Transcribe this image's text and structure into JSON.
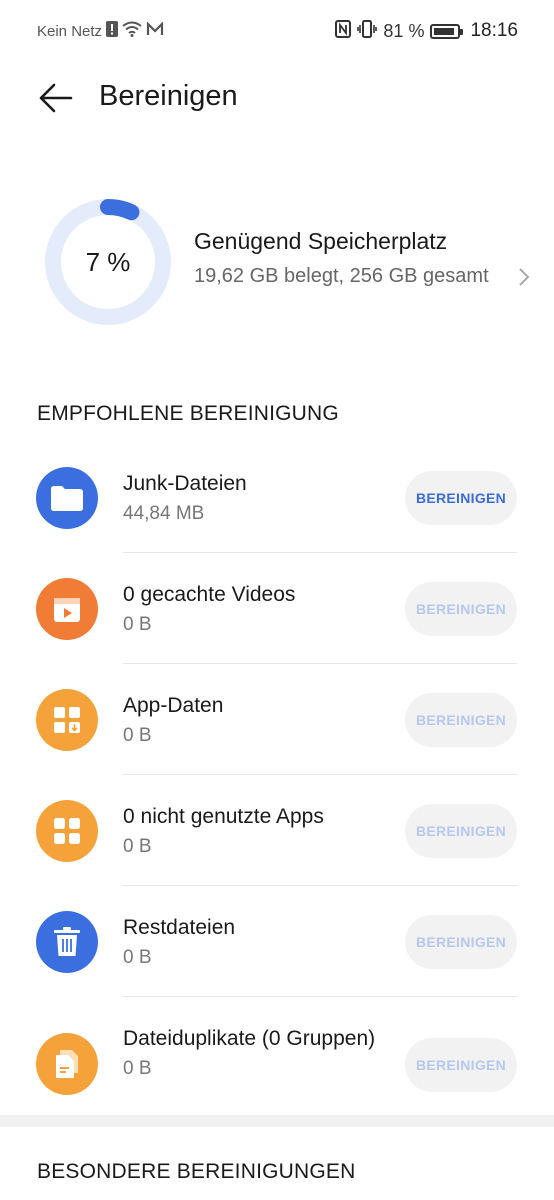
{
  "status_bar": {
    "carrier": "Kein Netz",
    "battery": "81 %",
    "time": "18:16"
  },
  "header": {
    "title": "Bereinigen"
  },
  "storage": {
    "percent_label": "7 %",
    "percent_used": 0.07,
    "title": "Genügend Speicherplatz",
    "subtitle": "19,62 GB belegt, 256 GB gesamt"
  },
  "recommended": {
    "header": "EMPFOHLENE BEREINIGUNG",
    "items": [
      {
        "name": "Junk-Dateien",
        "size": "44,84 MB",
        "button": "BEREINIGEN",
        "icon": "folder-icon",
        "color": "#3b6fe0",
        "enabled": true
      },
      {
        "name": "0 gecachte Videos",
        "size": "0 B",
        "button": "BEREINIGEN",
        "icon": "video-icon",
        "color": "#f07c35",
        "enabled": false
      },
      {
        "name": "App-Daten",
        "size": "0 B",
        "button": "BEREINIGEN",
        "icon": "app-data-icon",
        "color": "#f5a23a",
        "enabled": false
      },
      {
        "name": "0 nicht genutzte Apps",
        "size": "0 B",
        "button": "BEREINIGEN",
        "icon": "apps-grid-icon",
        "color": "#f5a23a",
        "enabled": false
      },
      {
        "name": "Restdateien",
        "size": "0 B",
        "button": "BEREINIGEN",
        "icon": "trash-icon",
        "color": "#3b6fe0",
        "enabled": false
      },
      {
        "name": "Dateiduplikate (0 Gruppen)",
        "size": "0 B",
        "button": "BEREINIGEN",
        "icon": "duplicate-files-icon",
        "color": "#f5a23a",
        "enabled": false
      }
    ]
  },
  "special": {
    "header": "BESONDERE BEREINIGUNGEN"
  }
}
